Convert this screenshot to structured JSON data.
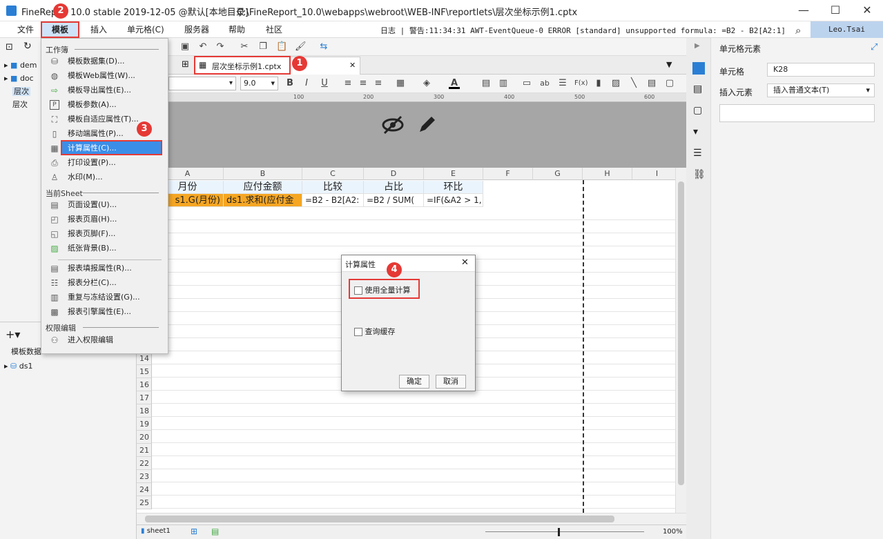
{
  "window": {
    "title": "FineRep▒10.0 stable 2019-12-05 @默认[本地目录]",
    "title_a": "FineRep",
    "title_b": "10.0 stable 2019-12-05 @默认[本地目录]",
    "path": "C:\\FineReport_10.0\\webapps\\webroot\\WEB-INF\\reportlets\\层次坐标示例1.cptx",
    "minimize": "—",
    "maximize": "☐",
    "close": "✕"
  },
  "menubar": {
    "items": [
      "文件",
      "模板",
      "插入",
      "单元格(C)",
      "服务器",
      "帮助",
      "社区"
    ],
    "log": "日志 | 警告:11:34:31 AWT-EventQueue-0 ERROR [standard] unsupported formula: =B2 - B2[A2:1]",
    "user": "Leo.Tsai"
  },
  "tab": {
    "label": "层次坐标示例1.cptx",
    "close": "✕"
  },
  "toolbar2": {
    "font_size": "9.0"
  },
  "ruler": [
    "100",
    "200",
    "300",
    "400",
    "500",
    "600",
    "700"
  ],
  "grid": {
    "columns": [
      "A",
      "B",
      "C",
      "D",
      "E",
      "F",
      "G",
      "H",
      "I"
    ],
    "rows": [
      "14",
      "15",
      "16",
      "17",
      "18",
      "19",
      "20",
      "21",
      "22",
      "23",
      "24",
      "25"
    ],
    "headers": [
      "月份",
      "应付金额",
      "比较",
      "占比",
      "环比"
    ],
    "data": [
      "s1.G(月份)",
      "ds1.求和(应付金",
      "=B2 - B2[A2:",
      "=B2 / SUM(",
      "=IF(&A2 > 1,"
    ]
  },
  "left_panel": {
    "tree": [
      "dem",
      "doc",
      "层次",
      "层次"
    ],
    "datasets_label": "模板数据",
    "dataset": "ds1"
  },
  "menu": {
    "section_workbook": "工作簿",
    "section_sheet": "当前Sheet",
    "section_auth": "权限编辑",
    "items_workbook": [
      {
        "label": "模板数据集(D)...",
        "icon": "database-icon"
      },
      {
        "label": "模板Web属性(W)...",
        "icon": "globe-icon"
      },
      {
        "label": "模板导出属性(E)...",
        "icon": "export-icon"
      },
      {
        "label": "模板参数(A)...",
        "icon": "parameter-icon"
      },
      {
        "label": "模板自适应属性(T)...",
        "icon": "adaptive-icon"
      },
      {
        "label": "移动端属性(P)...",
        "icon": "mobile-icon"
      },
      {
        "label": "计算属性(C)...",
        "icon": "calculator-icon"
      },
      {
        "label": "打印设置(P)...",
        "icon": "printer-icon"
      },
      {
        "label": "水印(M)...",
        "icon": "watermark-icon"
      }
    ],
    "items_sheet": [
      {
        "label": "页面设置(U)...",
        "icon": "page-setup-icon"
      },
      {
        "label": "报表页眉(H)...",
        "icon": "header-icon"
      },
      {
        "label": "报表页脚(F)...",
        "icon": "footer-icon"
      },
      {
        "label": "纸张背景(B)...",
        "icon": "background-icon"
      }
    ],
    "items_sheet2": [
      {
        "label": "报表填报属性(R)...",
        "icon": "fill-icon"
      },
      {
        "label": "报表分栏(C)...",
        "icon": "columns-icon"
      },
      {
        "label": "重复与冻结设置(G)...",
        "icon": "freeze-icon"
      },
      {
        "label": "报表引擎属性(E)...",
        "icon": "engine-icon"
      }
    ],
    "items_auth": [
      {
        "label": "进入权限编辑",
        "icon": "permission-icon"
      }
    ]
  },
  "dialog": {
    "title": "计算属性",
    "option1": "使用全量计算",
    "option2": "查询缓存",
    "ok": "确定",
    "cancel": "取消"
  },
  "right_panel": {
    "title": "单元格元素",
    "cell_label": "单元格",
    "cell_value": "K28",
    "insert_label": "插入元素",
    "insert_value": "插入普通文本(T)"
  },
  "status": {
    "sheet": "sheet1",
    "zoom": "100%"
  },
  "badges": [
    "1",
    "2",
    "3",
    "4"
  ],
  "colors": {
    "accent": "#3b8ee8",
    "annotation": "#e53935",
    "data_cell": "#f5a623"
  }
}
